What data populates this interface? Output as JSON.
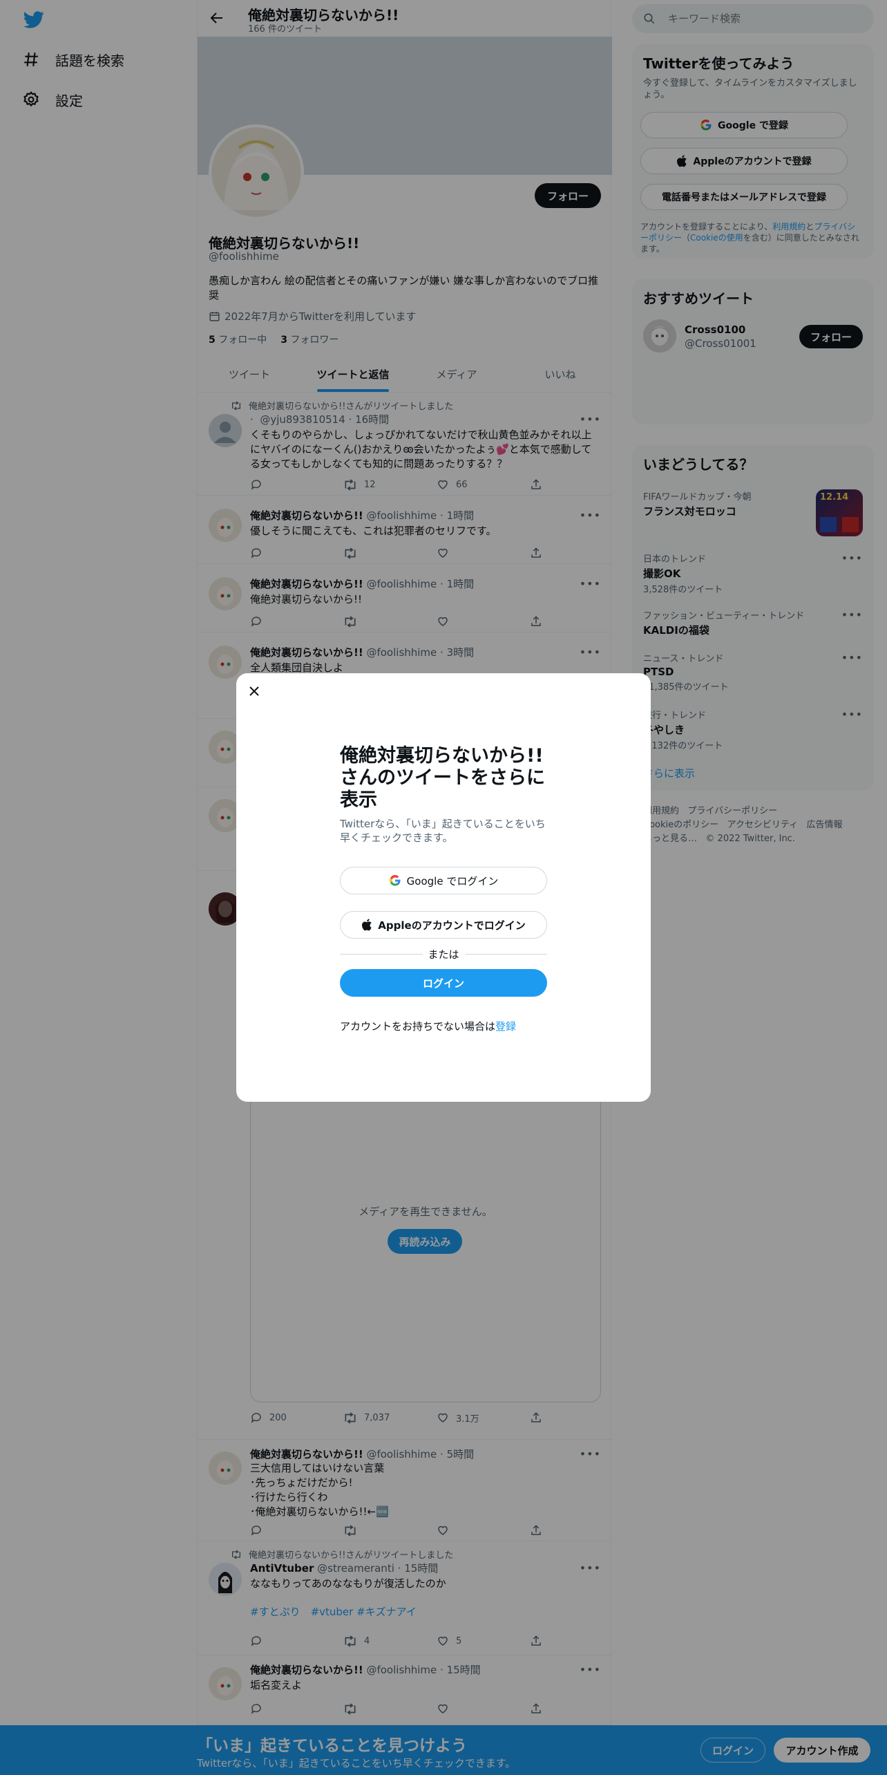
{
  "nav": {
    "explore_label": "話題を検索",
    "settings_label": "設定"
  },
  "profile_header": {
    "name": "俺絶対裏切らないから!!",
    "tweet_count": "166 件のツイート"
  },
  "profile": {
    "name": "俺絶対裏切らないから!!",
    "handle": "@foolishhime",
    "bio": "愚痴しか言わん 絵の配信者とその痛いファンが嫌い 嫌な事しか言わないのでブロ推奨",
    "joined": "2022年7月からTwitterを利用しています",
    "following_count": "5",
    "following_label": "フォロー中",
    "followers_count": "3",
    "followers_label": "フォロワー",
    "follow_label": "フォロー"
  },
  "tabs": [
    "ツイート",
    "ツイートと返信",
    "メディア",
    "いいね"
  ],
  "tweets": [
    {
      "retweet_note": "俺絶対裏切らないから!!さんがリツイートしました",
      "handle": "@yju893810514",
      "time": "16時間",
      "text": "くそもりのやらかし、しょっぴかれてないだけで秋山黄色並みかそれ以上にヤバイのになーくん()おかえりꙭ会いたかったよぅ💕と本気で感動してる女ってもしかしなくても知的に問題あったりする？？",
      "retweets": "12",
      "likes": "66"
    },
    {
      "name": "俺絶対裏切らないから!!",
      "handle": "@foolishhime",
      "time": "1時間",
      "text": "優しそうに聞こえても、これは犯罪者のセリフです。"
    },
    {
      "name": "俺絶対裏切らないから!!",
      "handle": "@foolishhime",
      "time": "1時間",
      "text": "俺絶対裏切らないから!!"
    },
    {
      "name": "俺絶対裏切らないから!!",
      "handle": "@foolishhime",
      "time": "3時間",
      "text": "全人類集団自決しよ"
    },
    {
      "media_error": "メディアを再生できません。",
      "reload_label": "再読み込み",
      "replies": "200",
      "retweets": "7,037",
      "likes": "3.1万"
    },
    {
      "name": "俺絶対裏切らないから!!",
      "handle": "@foolishhime",
      "time": "5時間",
      "lines": [
        "三大信用してはいけない言葉",
        "･先っちょだけだから!",
        "･行けたら行くわ",
        "･俺絶対裏切らないから!!←🆕"
      ]
    },
    {
      "retweet_note": "俺絶対裏切らないから!!さんがリツイートしました",
      "name": "AntiVtuber",
      "handle": "@streameranti",
      "time": "15時間",
      "text": "ななもりってあのななもりが復活したのか",
      "hashtags": "#すとぷり　#vtuber #キズナアイ",
      "retweets": "4",
      "likes": "5"
    },
    {
      "name": "俺絶対裏切らないから!!",
      "handle": "@foolishhime",
      "time": "15時間",
      "text": "垢名変えよ"
    }
  ],
  "search": {
    "placeholder": "キーワード検索"
  },
  "signup_card": {
    "title": "Twitterを使ってみよう",
    "subtitle": "今すぐ登録して、タイムラインをカスタマイズしましょう。",
    "google_label": "Google で登録",
    "apple_label": "Appleのアカウントで登録",
    "phone_label": "電話番号またはメールアドレスで登録",
    "legal_1": "アカウントを登録することにより、",
    "legal_terms": "利用規約",
    "legal_2": "と",
    "legal_privacy": "プライバシーポリシー",
    "legal_3": "（",
    "legal_cookie": "Cookieの使用",
    "legal_4": "を含む）に同意したとみなされます。"
  },
  "recommended": {
    "title": "おすすめツイート",
    "name": "Cross0100",
    "handle": "@Cross01001",
    "follow_label": "フォロー"
  },
  "trends": {
    "title": "いまどうしてる？",
    "items": [
      {
        "category": "FIFAワールドカップ・今朝",
        "name": "フランス対モロッコ"
      },
      {
        "category": "日本のトレンド",
        "name": "撮影OK",
        "count": "3,528件のツイート"
      },
      {
        "category": "ファッション・ビューティー・トレンド",
        "name": "KALDIの福袋"
      },
      {
        "category": "ニュース・トレンド",
        "name": "PTSD",
        "count": "11,385件のツイート"
      },
      {
        "category": "旅行・トレンド",
        "name": "冬やしき",
        "count": "2,132件のツイート"
      }
    ],
    "show_more": "さらに表示"
  },
  "footer": [
    "利用規約",
    "プライバシーポリシー",
    "Cookieのポリシー",
    "アクセシビリティ",
    "広告情報",
    "もっと見る…",
    "© 2022 Twitter, Inc."
  ],
  "modal": {
    "title": "俺絶対裏切らないから!!さんのツイートをさらに表示",
    "subtitle": "Twitterなら、「いま」起きていることをいち早くチェックできます。",
    "google_label": "Google でログイン",
    "apple_label": "Appleのアカウントでログイン",
    "or_label": "または",
    "login_label": "ログイン",
    "signup_prompt": "アカウントをお持ちでない場合は",
    "signup_link": "登録"
  },
  "banner": {
    "title": "「いま」起きていることを見つけよう",
    "subtitle": "Twitterなら、「いま」起きていることをいち早くチェックできます。",
    "login_label": "ログイン",
    "signup_label": "アカウント作成"
  },
  "colors": {
    "accent": "#1d9bf0",
    "banner_image": "#cfd9de",
    "overlay": "rgba(0,0,0,0.4)"
  }
}
